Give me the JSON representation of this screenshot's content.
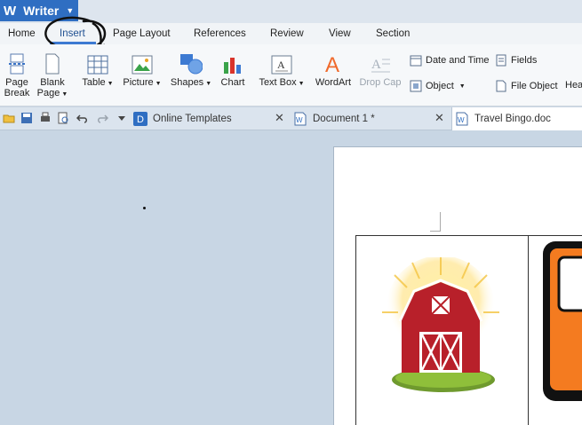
{
  "app": {
    "name": "Writer",
    "logo": "W"
  },
  "menu": {
    "tabs": [
      "Home",
      "Insert",
      "Page Layout",
      "References",
      "Review",
      "View",
      "Section"
    ],
    "active": "Insert"
  },
  "ribbon": {
    "page_break": [
      "Page",
      "Break"
    ],
    "blank_page": [
      "Blank",
      "Page"
    ],
    "table": "Table",
    "picture": "Picture",
    "shapes": "Shapes",
    "chart": "Chart",
    "text_box": "Text Box",
    "wordart": "WordArt",
    "drop_cap": "Drop Cap",
    "date_time": "Date and Time",
    "fields": "Fields",
    "object": "Object",
    "file_object": "File Object",
    "header_cut": "Hea"
  },
  "doc_tabs": [
    {
      "label": "Online Templates"
    },
    {
      "label": "Document 1 *"
    },
    {
      "label": "Travel Bingo.doc"
    }
  ],
  "colors": {
    "accent": "#2f6ec2",
    "barn_red": "#b8202a",
    "orange": "#f47b20"
  }
}
